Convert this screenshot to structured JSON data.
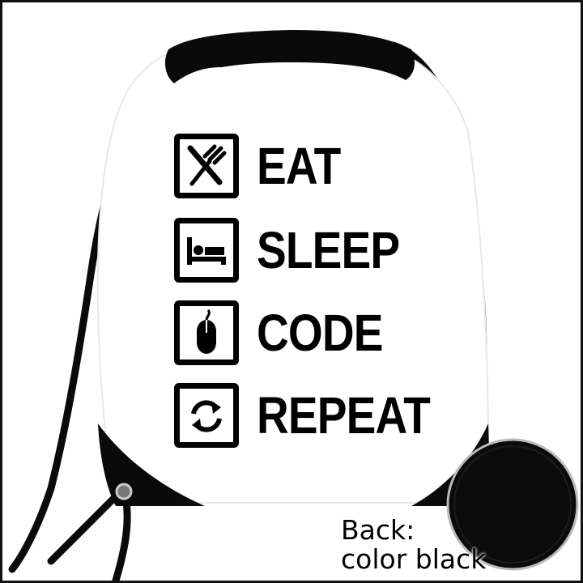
{
  "print": {
    "rows": [
      {
        "icon": "fork-knife-icon",
        "word": "EAT"
      },
      {
        "icon": "bed-icon",
        "word": "SLEEP"
      },
      {
        "icon": "mouse-icon",
        "word": "CODE"
      },
      {
        "icon": "refresh-arrows-icon",
        "word": "REPEAT"
      }
    ]
  },
  "caption": {
    "line1": "Back:",
    "line2": "color black"
  },
  "colors": {
    "bag_body": "#ffffff",
    "bag_trim": "#000000",
    "background": "#ffffff",
    "print": "#000000"
  }
}
